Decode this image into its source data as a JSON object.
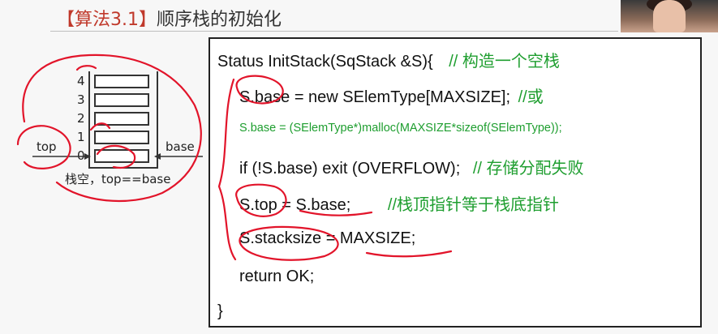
{
  "title": {
    "prefix": "【算法3.1】",
    "suffix": "顺序栈的初始化"
  },
  "colors": {
    "title_accent": "#c0392b",
    "comment": "#1e9e2f",
    "annotation_red": "#e2142a",
    "code_text": "#111111"
  },
  "stack_diagram": {
    "indices": [
      "4",
      "3",
      "2",
      "1",
      "0"
    ],
    "top_label": "top",
    "base_label": "base",
    "caption": "栈空，top==base"
  },
  "code": {
    "line1_code": "Status InitStack(SqStack    &S){",
    "line1_comment": "// 构造一个空栈",
    "line2_code": "S.base = new SElemType[MAXSIZE];",
    "line2_comment": "//或",
    "line3": "S.base = (SElemType*)malloc(MAXSIZE*sizeof(SElemType));",
    "line4_code": "if  (!S.base) exit  (OVERFLOW);",
    "line4_comment": "// 存储分配失败",
    "line5_code": "S.top = S.base;",
    "line5_comment": "//栈顶指针等于栈底指针",
    "line6": "S.stacksize = MAXSIZE;",
    "line7": "return OK;",
    "line8": "}"
  }
}
